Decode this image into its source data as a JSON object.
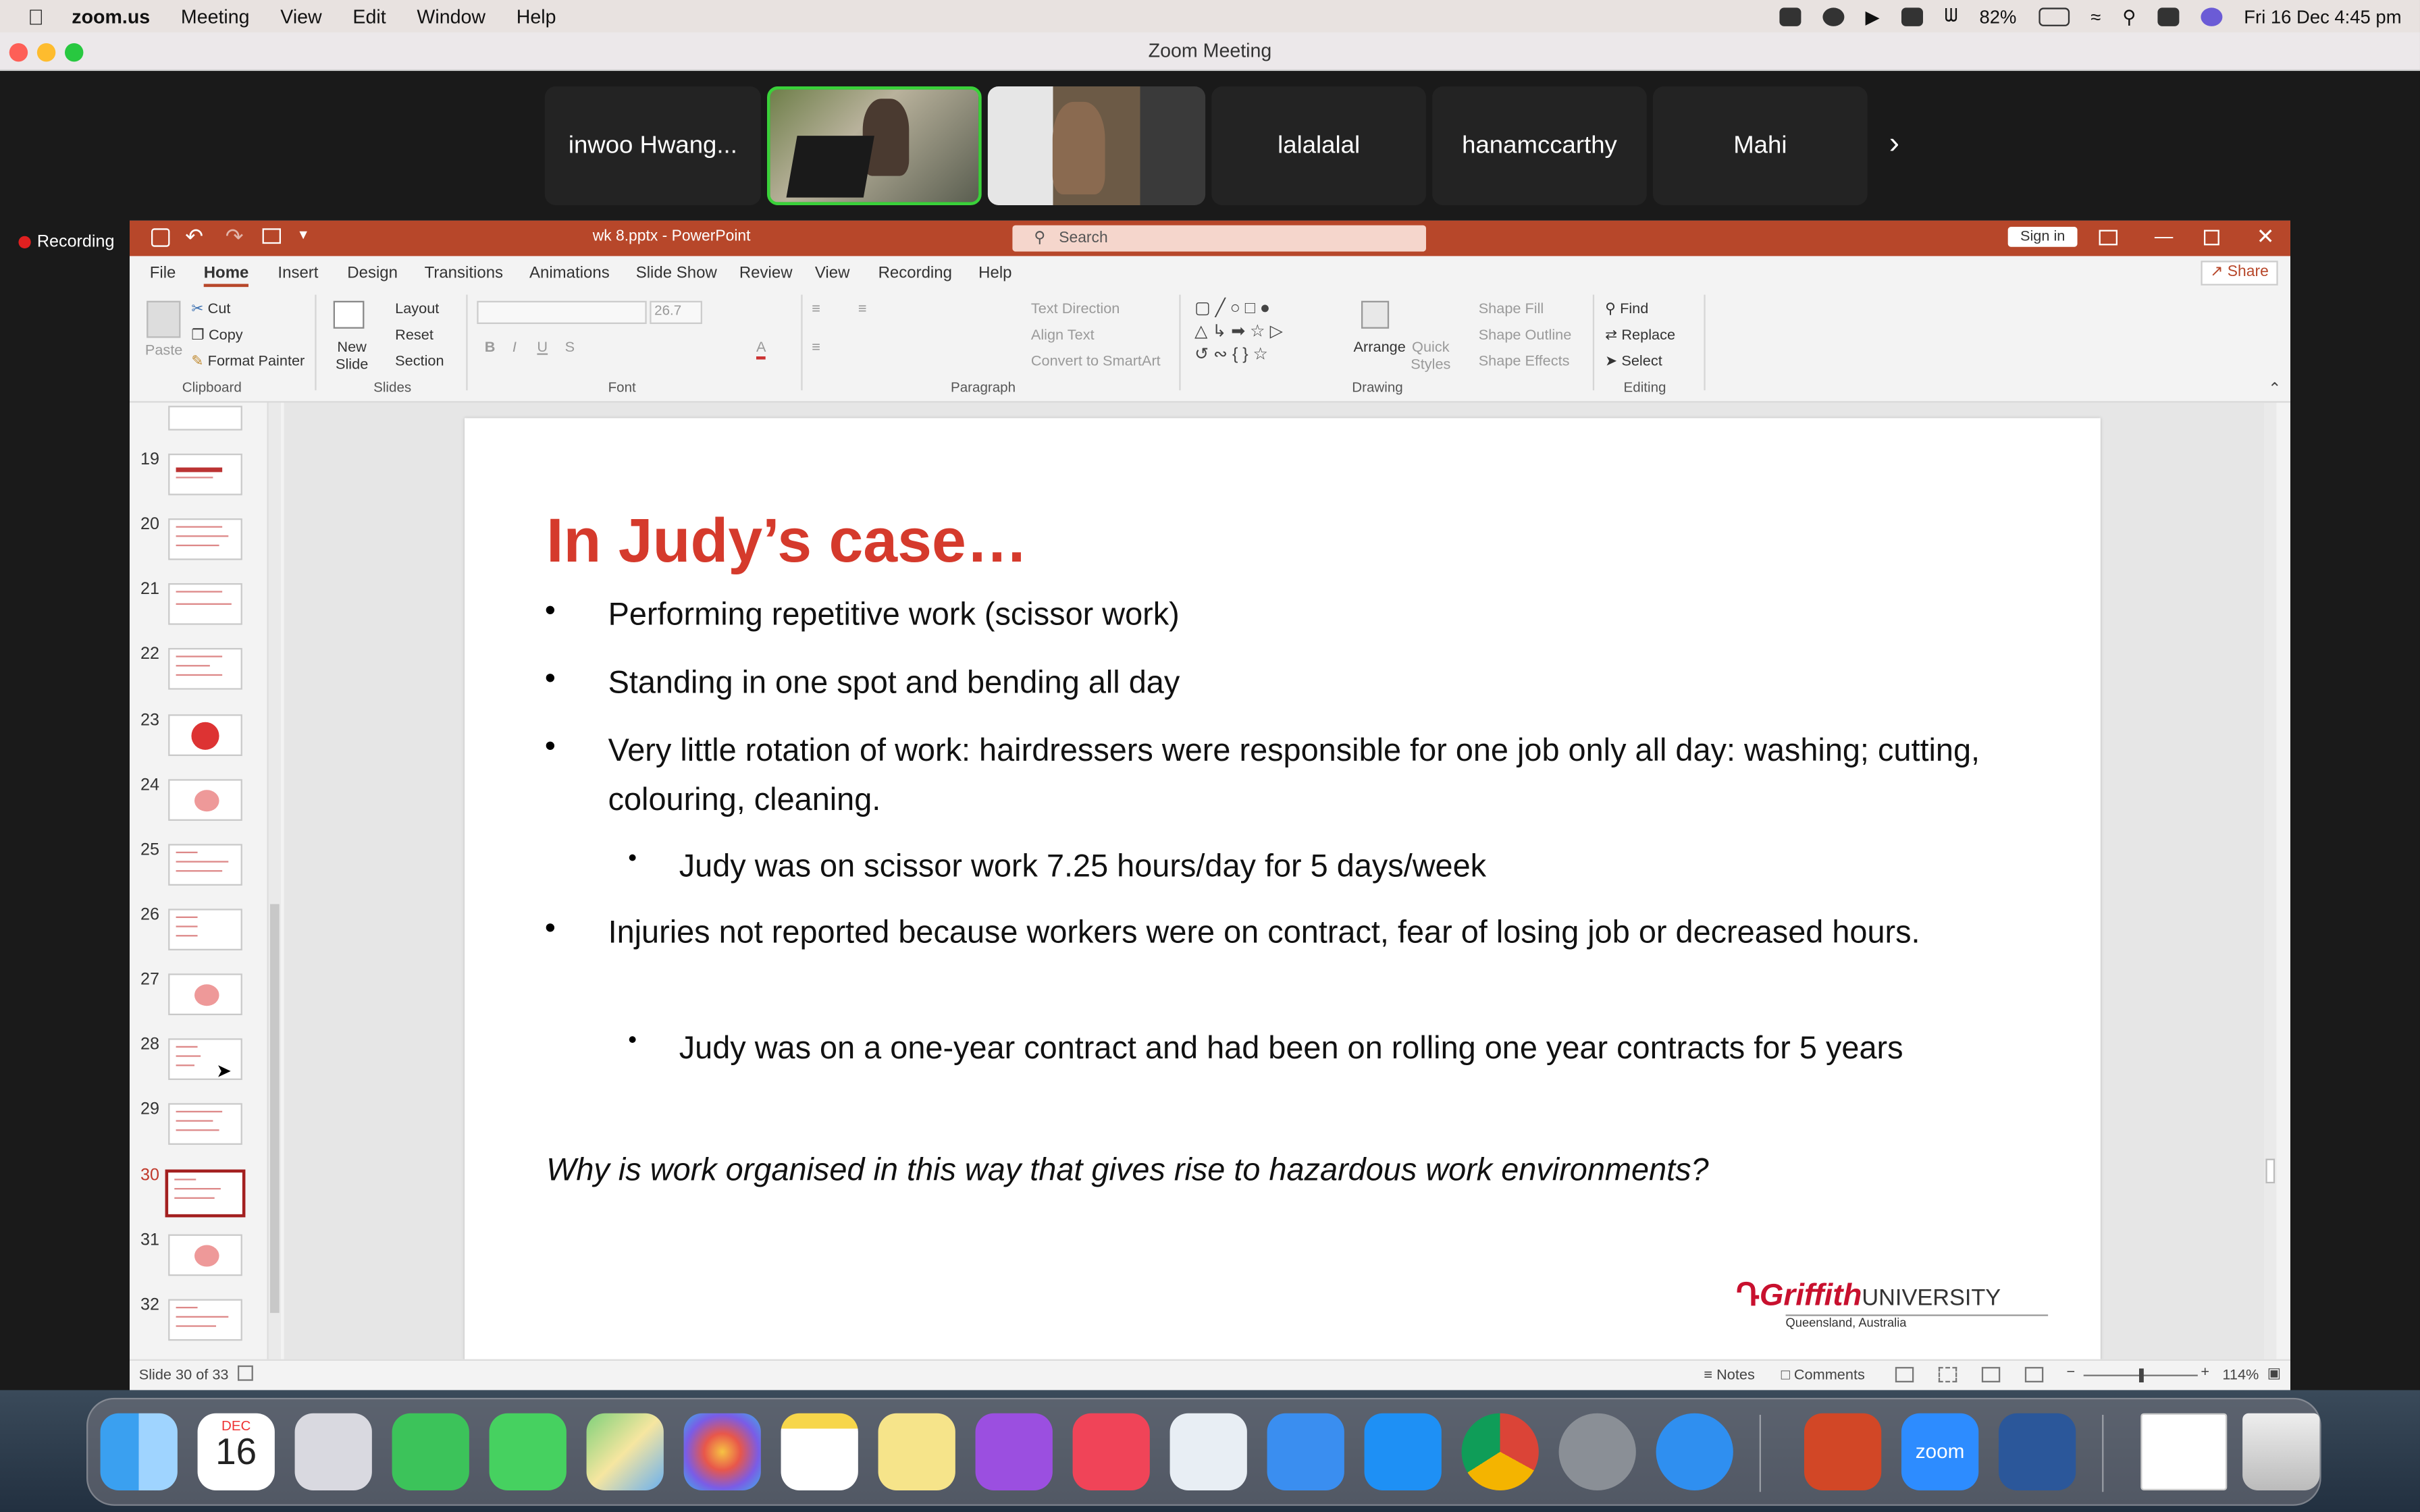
{
  "menubar": {
    "app": "zoom.us",
    "items": [
      "Meeting",
      "View",
      "Edit",
      "Window",
      "Help"
    ],
    "battery": "82%",
    "datetime": "Fri 16 Dec  4:45 pm"
  },
  "zoom": {
    "window_title": "Zoom Meeting",
    "recording_label": "Recording",
    "participants": [
      "inwoo Hwang...",
      "lalalalal",
      "hanamccarthy",
      "Mahi"
    ]
  },
  "ppt": {
    "title": "wk 8.pptx  -  PowerPoint",
    "search_placeholder": "Search",
    "sign_in": "Sign in",
    "share": "Share",
    "tabs": [
      "File",
      "Home",
      "Insert",
      "Design",
      "Transitions",
      "Animations",
      "Slide Show",
      "Review",
      "View",
      "Recording",
      "Help"
    ],
    "ribbon": {
      "paste": "Paste",
      "cut": "Cut",
      "copy": "Copy",
      "format_painter": "Format Painter",
      "clipboard": "Clipboard",
      "new_slide": "New Slide",
      "layout": "Layout",
      "reset": "Reset",
      "section": "Section",
      "slides": "Slides",
      "font_size": "26.7",
      "font": "Font",
      "text_direction": "Text Direction",
      "align_text": "Align Text",
      "convert_smartart": "Convert to SmartArt",
      "paragraph": "Paragraph",
      "arrange": "Arrange",
      "quick_styles": "Quick Styles",
      "shape_fill": "Shape Fill",
      "shape_outline": "Shape Outline",
      "shape_effects": "Shape Effects",
      "drawing": "Drawing",
      "find": "Find",
      "replace": "Replace",
      "select": "Select",
      "editing": "Editing"
    },
    "thumbnails": [
      "19",
      "20",
      "21",
      "22",
      "23",
      "24",
      "25",
      "26",
      "27",
      "28",
      "29",
      "30",
      "31",
      "32"
    ],
    "slide": {
      "title": "In Judy’s case…",
      "bullets": [
        "Performing repetitive work (scissor work)",
        "Standing in one spot and bending all day",
        "Very little rotation of work: hairdressers were responsible for one job only all day:  washing; cutting, colouring, cleaning.",
        "Judy was on scissor work 7.25 hours/day for 5 days/week",
        "Injuries not reported because workers were on contract, fear of losing job or decreased hours.",
        "Judy was on a one-year contract and had been on rolling one year contracts for 5 years"
      ],
      "question": "Why is work organised in this way that gives rise to hazardous work environments?",
      "logo_main": "Griffith",
      "logo_uni": "UNIVERSITY",
      "logo_sub": "Queensland, Australia"
    },
    "status": {
      "slide_count": "Slide 30 of 33",
      "notes": "Notes",
      "comments": "Comments",
      "zoom": "114%"
    }
  },
  "dock": {
    "calendar_month": "DEC",
    "calendar_day": "16",
    "zoom_label": "zoom"
  }
}
